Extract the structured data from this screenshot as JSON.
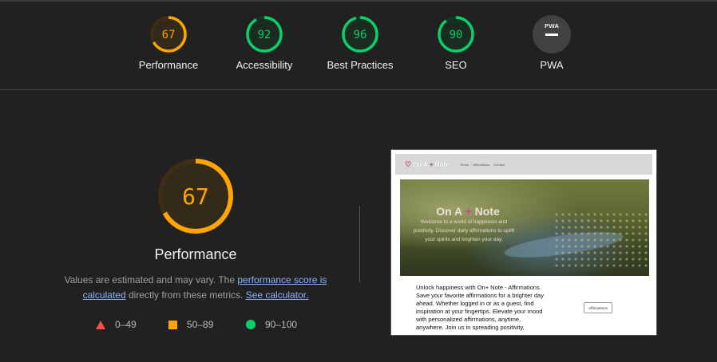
{
  "categories": [
    {
      "label": "Performance",
      "score": 67,
      "color": "#ffa400",
      "track": "#3d2e14",
      "fill": "#332a1a"
    },
    {
      "label": "Accessibility",
      "score": 92,
      "color": "#0cce6b",
      "track": "#12391f",
      "fill": "#1a2b1f"
    },
    {
      "label": "Best Practices",
      "score": 96,
      "color": "#0cce6b",
      "track": "#12391f",
      "fill": "#1a2b1f"
    },
    {
      "label": "SEO",
      "score": 90,
      "color": "#0cce6b",
      "track": "#12391f",
      "fill": "#1a2b1f"
    },
    {
      "label": "PWA",
      "badge": "PWA",
      "color": "#ffffff"
    }
  ],
  "main": {
    "score": 67,
    "title": "Performance",
    "note_prefix": "Values are estimated and may vary. The ",
    "note_link1": "performance score is calculated",
    "note_mid": " directly from these metrics. ",
    "note_link2": "See calculator."
  },
  "legend": {
    "fail": "0–49",
    "average": "50–89",
    "pass": "90–100"
  },
  "thumbnail": {
    "logo_prefix": "On A ",
    "logo_plus": "+",
    "logo_suffix": " Note",
    "nav_home": "Home",
    "nav_affirmations": "Affirmations",
    "nav_contact": "Contact",
    "hero_prefix": "On A ",
    "hero_plus": "+",
    "hero_suffix": " Note",
    "hero_sub": "Welcome to a world of happiness and positivity. Discover daily affirmations to uplift your spirits and brighten your day.",
    "body": "Unlock happiness with On+ Note - Affirmations. Save your favorite affirmations for a brighter day ahead. Whether logged in or as a guest, find inspiration at your fingertips. Elevate your mood with personalized affirmations, anytime, anywhere. Join us in spreading positivity, effortlessly.",
    "button": "Affirmations"
  },
  "colors": {
    "fail": "#ff4e42",
    "average": "#ffa400",
    "pass": "#0cce6b",
    "link": "#8ab4f8"
  }
}
